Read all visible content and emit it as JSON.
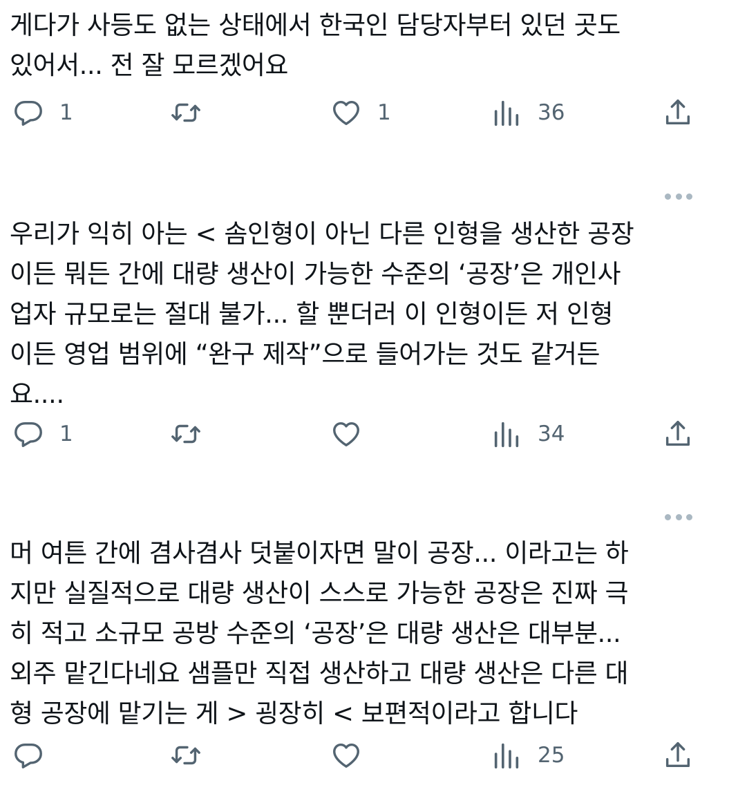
{
  "tweets": [
    {
      "text": "게다가 사등도 없는 상태에서 한국인 담당자부터 있던 곳도\n있어서... 전 잘 모르겠어요",
      "show_more": false,
      "replies": "1",
      "retweets": "",
      "likes": "1",
      "views": "36"
    },
    {
      "text": "우리가 익히 아는 < 솜인형이 아닌 다른 인형을 생산한 공장\n이든 뭐든 간에 대량 생산이 가능한 수준의 ‘공장’은 개인사\n업자 규모로는 절대 불가... 할 뿐더러 이 인형이든 저 인형\n이든 영업 범위에 “완구 제작”으로 들어가는 것도 같거든\n요....",
      "show_more": true,
      "replies": "1",
      "retweets": "",
      "likes": "",
      "views": "34"
    },
    {
      "text": "머 여튼 간에 겸사겸사 덧붙이자면 말이 공장... 이라고는 하\n지만 실질적으로 대량 생산이 스스로 가능한 공장은 진짜 극\n히 적고 소규모 공방 수준의 ‘공장’은 대량 생산은 대부분...\n외주 맡긴다네요 샘플만 직접 생산하고 대량 생산은 다른 대\n형 공장에 맡기는 게 > 굉장히 < 보편적이라고 합니다",
      "show_more": true,
      "replies": "",
      "retweets": "",
      "likes": "",
      "views": "25"
    }
  ],
  "icons": {
    "reply": "speech-bubble-icon",
    "retweet": "retweet-arrows-icon",
    "like": "heart-icon",
    "views": "bar-chart-icon",
    "share": "share-upload-icon",
    "more": "more-dots-icon"
  },
  "colors": {
    "text": "#0f1419",
    "icon": "#536471",
    "more_dots": "#aab8c2",
    "background": "#ffffff"
  }
}
